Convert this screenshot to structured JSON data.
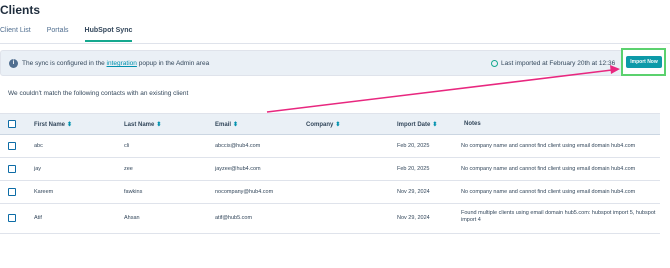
{
  "page": {
    "title": "Clients"
  },
  "tabs": [
    {
      "label": "Client List"
    },
    {
      "label": "Portals"
    },
    {
      "label": "HubSpot Sync",
      "active": true
    }
  ],
  "banner": {
    "text_before": "The sync is configured in the ",
    "link": "integration",
    "text_after": " popup in the Admin area",
    "last_imported": "Last imported at February 20th at 12:36",
    "import_button": "Import Now"
  },
  "message": "We couldn't match the following contacts with an existing client",
  "table": {
    "columns": [
      "First Name",
      "Last Name",
      "Email",
      "Company",
      "Import Date",
      "Notes"
    ],
    "rows": [
      {
        "first": "abc",
        "last": "cli",
        "email": "abccis@hub4.com",
        "company": "",
        "date": "Feb 20, 2025",
        "notes": "No company name and cannot find client using email domain hub4.com"
      },
      {
        "first": "jay",
        "last": "zee",
        "email": "jayzee@hub4.com",
        "company": "",
        "date": "Feb 20, 2025",
        "notes": "No company name and cannot find client using email domain hub4.com"
      },
      {
        "first": "Kareem",
        "last": "fawkins",
        "email": "nocompany@hub4.com",
        "company": "",
        "date": "Nov 29, 2024",
        "notes": "No company name and cannot find client using email domain hub4.com"
      },
      {
        "first": "Atif",
        "last": "Ahsan",
        "email": "atif@hub5.com",
        "company": "",
        "date": "Nov 29, 2024",
        "notes": "Found multiple clients using email domain hub5.com: hubspot import 5, hubspot import 4"
      }
    ]
  },
  "colors": {
    "accent": "#15a88f",
    "button": "#0d9aa8",
    "highlight": "#5bd16e",
    "arrow": "#e8277f"
  },
  "icons": {
    "info": "info-icon",
    "clock": "clock-icon",
    "sort": "sort-icon",
    "arrow": "annotation-arrow"
  }
}
